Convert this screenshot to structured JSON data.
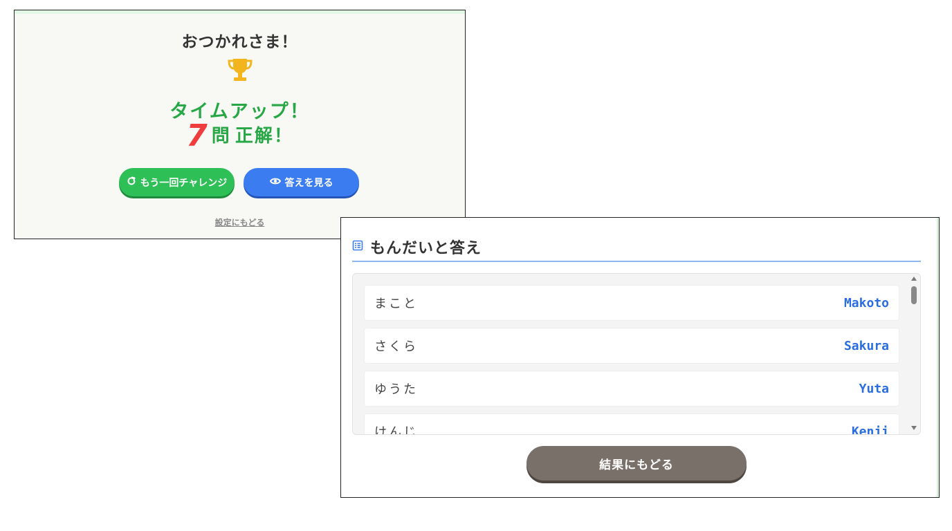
{
  "result": {
    "title": "おつかれさま！",
    "timeup": "タイムアップ！",
    "score": "7",
    "score_unit": "問",
    "score_text": "正解！",
    "retry_label": "もう一回チャレンジ",
    "answers_label": "答えを見る",
    "back_settings_label": "設定にもどる",
    "colors": {
      "green": "#27a745",
      "red": "#ef3c3c",
      "blue": "#3b7df0"
    }
  },
  "answers": {
    "title": "もんだいと答え",
    "rows": [
      {
        "question": "まこと",
        "answer": "Makoto"
      },
      {
        "question": "さくら",
        "answer": "Sakura"
      },
      {
        "question": "ゆうた",
        "answer": "Yuta"
      },
      {
        "question": "けんじ",
        "answer": "Kenji"
      }
    ],
    "back_results_label": "結果にもどる"
  },
  "icons": {
    "trophy": "trophy-icon",
    "retry": "refresh-icon",
    "answers": "eye-icon",
    "list": "list-icon"
  }
}
